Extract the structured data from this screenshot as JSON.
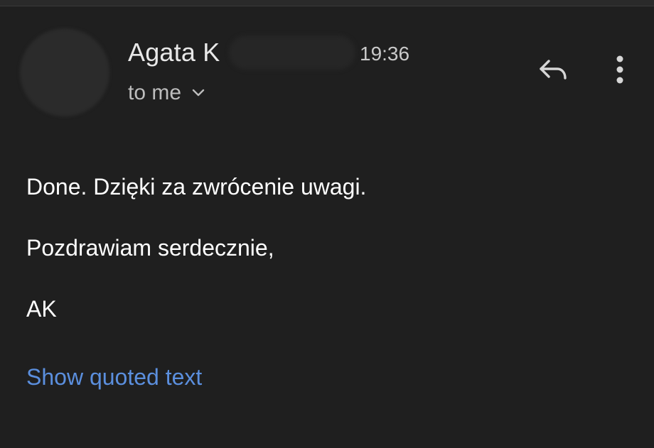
{
  "email": {
    "sender_name": "Agata K",
    "time": "19:36",
    "recipient": "to me",
    "body_lines": [
      "Done. Dzięki za zwrócenie uwagi.",
      "Pozdrawiam serdecznie,",
      "AK"
    ],
    "show_quoted_label": "Show quoted text"
  },
  "icons": {
    "reply": "reply-icon",
    "more": "more-vert-icon",
    "expand": "chevron-down-icon"
  },
  "colors": {
    "background": "#1f1f1f",
    "link": "#5b8fde",
    "text": "#ffffff",
    "secondary_text": "#bdbdbd"
  }
}
